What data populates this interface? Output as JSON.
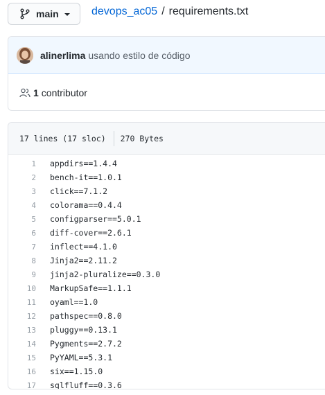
{
  "branch": {
    "label": "main",
    "icon": "git-branch-icon"
  },
  "breadcrumb": {
    "repo": "devops_ac05",
    "separator": "/",
    "file": "requirements.txt"
  },
  "commit": {
    "author": "alinerlima",
    "message": "usando estilo de código"
  },
  "contributors": {
    "count": "1",
    "label": "contributor"
  },
  "file": {
    "lines_info": "17 lines (17 sloc)",
    "size": "270 Bytes",
    "lines": [
      {
        "num": "1",
        "code": "appdirs==1.4.4"
      },
      {
        "num": "2",
        "code": "bench-it==1.0.1"
      },
      {
        "num": "3",
        "code": "click==7.1.2"
      },
      {
        "num": "4",
        "code": "colorama==0.4.4"
      },
      {
        "num": "5",
        "code": "configparser==5.0.1"
      },
      {
        "num": "6",
        "code": "diff-cover==2.6.1"
      },
      {
        "num": "7",
        "code": "inflect==4.1.0"
      },
      {
        "num": "8",
        "code": "Jinja2==2.11.2"
      },
      {
        "num": "9",
        "code": "jinja2-pluralize==0.3.0"
      },
      {
        "num": "10",
        "code": "MarkupSafe==1.1.1"
      },
      {
        "num": "11",
        "code": "oyaml==1.0"
      },
      {
        "num": "12",
        "code": "pathspec==0.8.0"
      },
      {
        "num": "13",
        "code": "pluggy==0.13.1"
      },
      {
        "num": "14",
        "code": "Pygments==2.7.2"
      },
      {
        "num": "15",
        "code": "PyYAML==5.3.1"
      },
      {
        "num": "16",
        "code": "six==1.15.0"
      },
      {
        "num": "17",
        "code": "sqlfluff==0.3.6"
      }
    ]
  },
  "colors": {
    "link": "#0366d6",
    "commit_bg": "#f1f8ff",
    "line_num": "#959da5"
  }
}
